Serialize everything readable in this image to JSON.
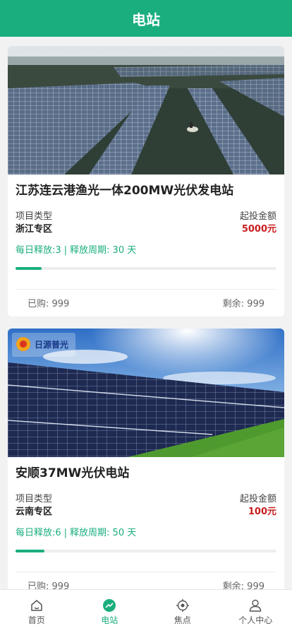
{
  "header": {
    "title": "电站"
  },
  "colors": {
    "accent": "#1aae7f",
    "amount": "#c81e1e"
  },
  "stations": [
    {
      "title": "江苏连云港渔光一体200MW光伏发电站",
      "type_label": "项目类型",
      "type_value": "浙江专区",
      "amount_label": "起投金额",
      "amount_value": "5000元",
      "daily_release": "每日释放:3",
      "release_period": "释放周期: 30 天",
      "progress": 0.1,
      "purchased": "已购: 999",
      "remaining": "剩余: 999",
      "image": "floating-solar-farm-photo"
    },
    {
      "title": "安顺37MW光伏电站",
      "type_label": "项目类型",
      "type_value": "云南专区",
      "amount_label": "起投金额",
      "amount_value": "100元",
      "daily_release": "每日释放:6",
      "release_period": "释放周期: 50 天",
      "progress": 0.11,
      "purchased": "已购: 999",
      "remaining": "剩余: 999",
      "image": "solar-panels-field-photo",
      "logo_text": "日源普光"
    }
  ],
  "tabbar": [
    {
      "label": "首页",
      "icon": "home-icon",
      "active": false
    },
    {
      "label": "电站",
      "icon": "trend-icon",
      "active": true
    },
    {
      "label": "焦点",
      "icon": "target-icon",
      "active": false
    },
    {
      "label": "个人中心",
      "icon": "user-icon",
      "active": false
    }
  ]
}
